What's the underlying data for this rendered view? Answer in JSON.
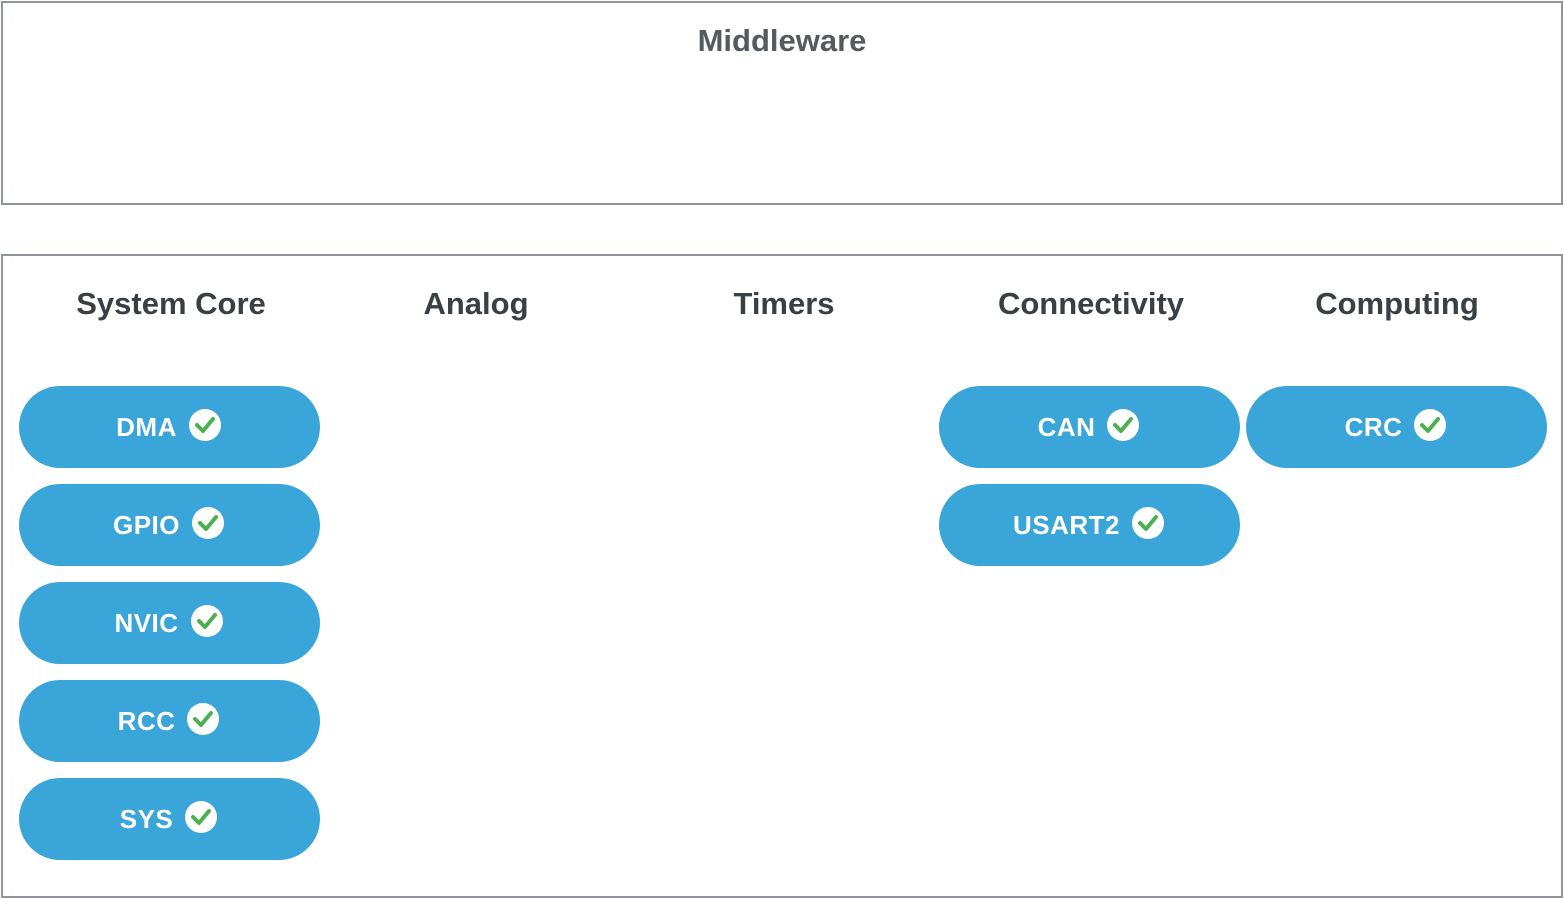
{
  "middleware": {
    "title": "Middleware"
  },
  "categories": [
    {
      "title": "System Core",
      "items": [
        {
          "label": "DMA",
          "status": "configured"
        },
        {
          "label": "GPIO",
          "status": "configured"
        },
        {
          "label": "NVIC",
          "status": "configured"
        },
        {
          "label": "RCC",
          "status": "configured"
        },
        {
          "label": "SYS",
          "status": "configured"
        }
      ]
    },
    {
      "title": "Analog",
      "items": []
    },
    {
      "title": "Timers",
      "items": []
    },
    {
      "title": "Connectivity",
      "items": [
        {
          "label": "CAN",
          "status": "configured"
        },
        {
          "label": "USART2",
          "status": "configured"
        }
      ]
    },
    {
      "title": "Computing",
      "items": [
        {
          "label": "CRC",
          "status": "configured"
        }
      ]
    }
  ],
  "colors": {
    "pill": "#3aa5d9",
    "check_fill": "#ffffff",
    "check_mark": "#4caf50",
    "border": "#8f959b",
    "title_text": "#3a3f44"
  },
  "icons": {
    "status": "check-circle-icon"
  }
}
